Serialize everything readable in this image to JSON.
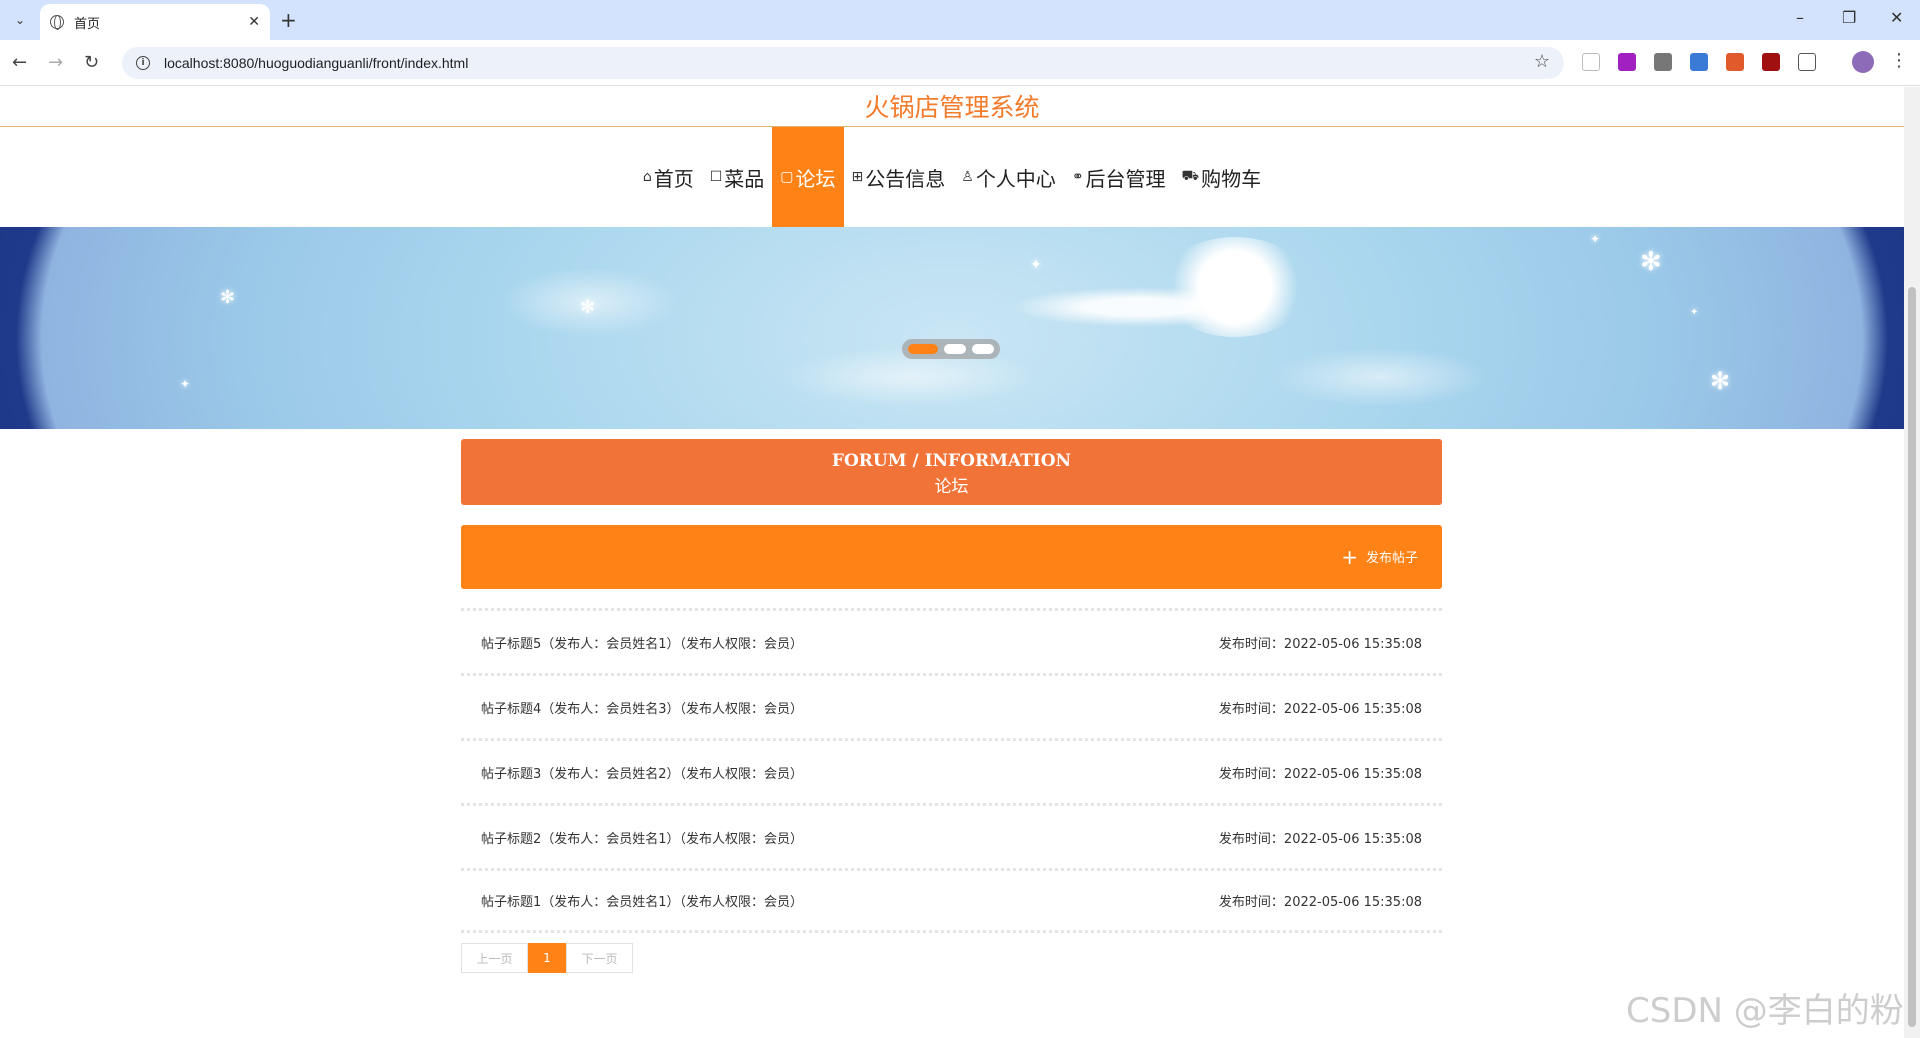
{
  "browser": {
    "tab_title": "首页",
    "url": "localhost:8080/huoguodianguanli/front/index.html"
  },
  "site": {
    "title": "火锅店管理系统"
  },
  "nav": {
    "items": [
      {
        "icon": "⌂",
        "label": "首页"
      },
      {
        "icon": "☐",
        "label": "菜品"
      },
      {
        "icon": "▢",
        "label": "论坛",
        "active": true
      },
      {
        "icon": "⊞",
        "label": "公告信息"
      },
      {
        "icon": "♙",
        "label": "个人中心"
      },
      {
        "icon": "⚭",
        "label": "后台管理"
      },
      {
        "icon": "⛟",
        "label": "购物车"
      }
    ]
  },
  "forum": {
    "title_en": "FORUM / INFORMATION",
    "title_cn": "论坛",
    "post_button": "发布帖子"
  },
  "posts": [
    {
      "title": "帖子标题5（发布人：会员姓名1）（发布人权限：会员）",
      "time": "发布时间：2022-05-06 15:35:08"
    },
    {
      "title": "帖子标题4（发布人：会员姓名3）（发布人权限：会员）",
      "time": "发布时间：2022-05-06 15:35:08"
    },
    {
      "title": "帖子标题3（发布人：会员姓名2）（发布人权限：会员）",
      "time": "发布时间：2022-05-06 15:35:08"
    },
    {
      "title": "帖子标题2（发布人：会员姓名1）（发布人权限：会员）",
      "time": "发布时间：2022-05-06 15:35:08"
    },
    {
      "title": "帖子标题1（发布人：会员姓名1）（发布人权限：会员）",
      "time": "发布时间：2022-05-06 15:35:08"
    }
  ],
  "pager": {
    "prev": "上一页",
    "current": "1",
    "next": "下一页"
  },
  "watermark": "CSDN @李白的粉",
  "colors": {
    "accent": "#fe8215",
    "forum_header": "#f27338",
    "title": "#f37b2c"
  }
}
